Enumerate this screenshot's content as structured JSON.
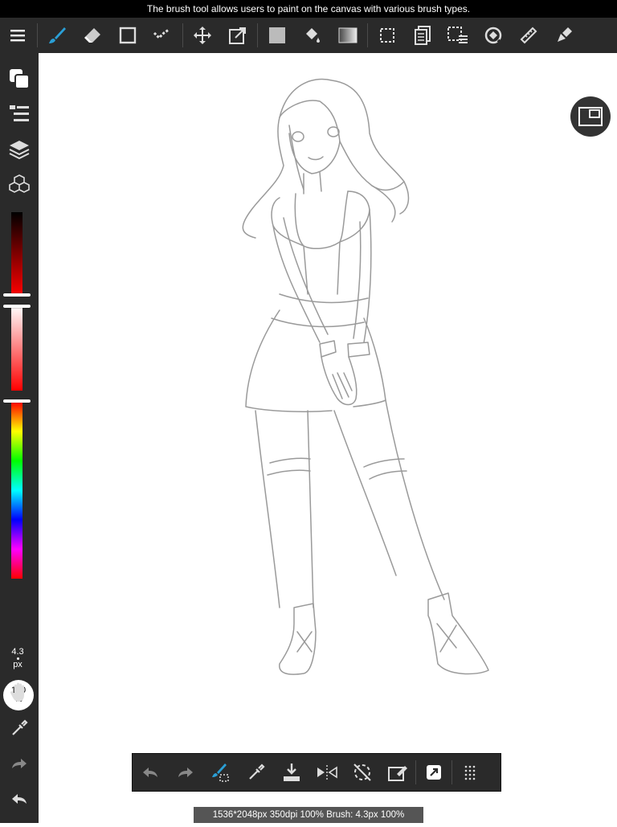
{
  "tooltip": "The brush tool allows users to paint on the canvas with various brush types.",
  "toolbar": {
    "menu_icon": "menu-icon",
    "tools": [
      "brush-tool-icon",
      "eraser-tool-icon",
      "rectangle-tool-icon",
      "dot-tool-icon",
      "move-tool-icon",
      "transform-tool-icon",
      "fill-color-icon",
      "bucket-icon",
      "gradient-icon",
      "select-icon",
      "copy-layers-icon",
      "select-layers-icon",
      "rotate-icon",
      "ruler-icon",
      "pen-icon"
    ],
    "active_tool": "brush-tool-icon"
  },
  "sidebar": {
    "icons": [
      "color-icon",
      "layer-props-icon",
      "layers-icon",
      "materials-icon"
    ],
    "brush_size_value": "4.3",
    "brush_size_unit": "px",
    "opacity_value": "100",
    "opacity_unit": "%",
    "hand_icon": "hand-icon",
    "eyedropper_icon": "eyedropper-icon",
    "redo_icon": "redo-icon",
    "undo_icon": "undo-icon"
  },
  "colors": {
    "accent": "#2a9fd6",
    "bar_bg": "#2a2a2a",
    "status_bg": "#555555"
  },
  "bottom_bar": {
    "icons": [
      "undo-icon",
      "redo-icon",
      "brush-options-icon",
      "eyedropper-icon",
      "save-icon",
      "flip-icon",
      "rotate-icon",
      "clear-icon",
      "snap-icon",
      "grid-icon"
    ]
  },
  "status": "1536*2048px 350dpi 100% Brush: 4.3px 100%"
}
